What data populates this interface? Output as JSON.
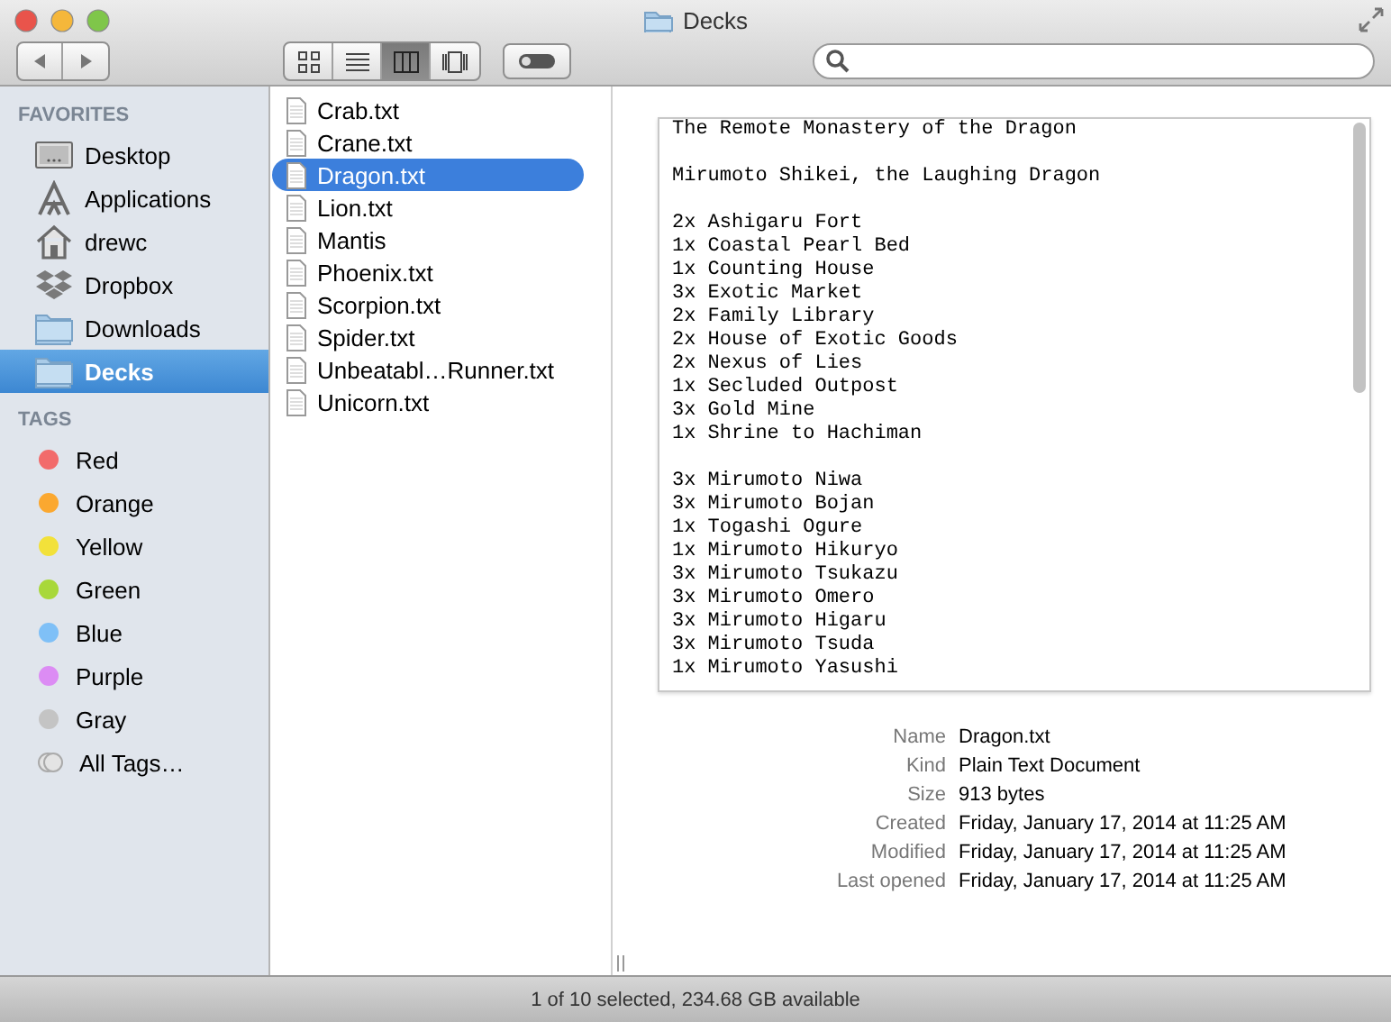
{
  "window": {
    "title": "Decks"
  },
  "toolbar": {
    "view_buttons": [
      {
        "kind": "icons",
        "selected": false
      },
      {
        "kind": "list",
        "selected": false
      },
      {
        "kind": "columns",
        "selected": true
      },
      {
        "kind": "coverflow",
        "selected": false
      }
    ]
  },
  "sidebar": {
    "favorites_heading": "FAVORITES",
    "favorites": [
      {
        "label": "Desktop",
        "kind": "desktop",
        "selected": false
      },
      {
        "label": "Applications",
        "kind": "applications",
        "selected": false
      },
      {
        "label": "drewc",
        "kind": "home",
        "selected": false
      },
      {
        "label": "Dropbox",
        "kind": "dropbox",
        "selected": false
      },
      {
        "label": "Downloads",
        "kind": "folder",
        "selected": false
      },
      {
        "label": "Decks",
        "kind": "folder",
        "selected": true
      }
    ],
    "tags_heading": "TAGS",
    "tags": [
      {
        "label": "Red",
        "color": "#f26b6b",
        "kind": "tag"
      },
      {
        "label": "Orange",
        "color": "#fba830",
        "kind": "tag"
      },
      {
        "label": "Yellow",
        "color": "#f2e13a",
        "kind": "tag"
      },
      {
        "label": "Green",
        "color": "#a8d83a",
        "kind": "tag"
      },
      {
        "label": "Blue",
        "color": "#7fc0f7",
        "kind": "tag"
      },
      {
        "label": "Purple",
        "color": "#dc8cf4",
        "kind": "tag"
      },
      {
        "label": "Gray",
        "color": "#c4c4c4",
        "kind": "tag"
      },
      {
        "label": "All Tags…",
        "kind": "all"
      }
    ]
  },
  "files": [
    {
      "name": "Crab.txt",
      "selected": false
    },
    {
      "name": "Crane.txt",
      "selected": false
    },
    {
      "name": "Dragon.txt",
      "selected": true
    },
    {
      "name": "Lion.txt",
      "selected": false
    },
    {
      "name": "Mantis",
      "selected": false
    },
    {
      "name": "Phoenix.txt",
      "selected": false
    },
    {
      "name": "Scorpion.txt",
      "selected": false
    },
    {
      "name": "Spider.txt",
      "selected": false
    },
    {
      "name": "Unbeatabl…Runner.txt",
      "selected": false
    },
    {
      "name": "Unicorn.txt",
      "selected": false
    }
  ],
  "preview": {
    "blocks": [
      [
        "The Remote Monastery of the Dragon"
      ],
      [
        "Mirumoto Shikei, the Laughing Dragon"
      ],
      [
        "2x Ashigaru Fort",
        "1x Coastal Pearl Bed",
        "1x Counting House",
        "3x Exotic Market",
        "2x Family Library",
        "2x House of Exotic Goods",
        "2x Nexus of Lies",
        "1x Secluded Outpost",
        "3x Gold Mine",
        "1x Shrine to Hachiman"
      ],
      [
        "3x Mirumoto Niwa",
        "3x Mirumoto Bojan",
        "1x Togashi Ogure",
        "1x Mirumoto Hikuryo",
        "3x Mirumoto Tsukazu",
        "3x Mirumoto Omero",
        "3x Mirumoto Higaru",
        "3x Mirumoto Tsuda",
        "1x Mirumoto Yasushi"
      ]
    ],
    "info": [
      {
        "label": "Name",
        "value": "Dragon.txt"
      },
      {
        "label": "Kind",
        "value": "Plain Text Document"
      },
      {
        "label": "Size",
        "value": "913 bytes"
      },
      {
        "label": "Created",
        "value": "Friday, January 17, 2014 at 11:25 AM"
      },
      {
        "label": "Modified",
        "value": "Friday, January 17, 2014 at 11:25 AM"
      },
      {
        "label": "Last opened",
        "value": "Friday, January 17, 2014 at 11:25 AM"
      }
    ]
  },
  "status_bar": "1 of 10 selected, 234.68 GB available"
}
